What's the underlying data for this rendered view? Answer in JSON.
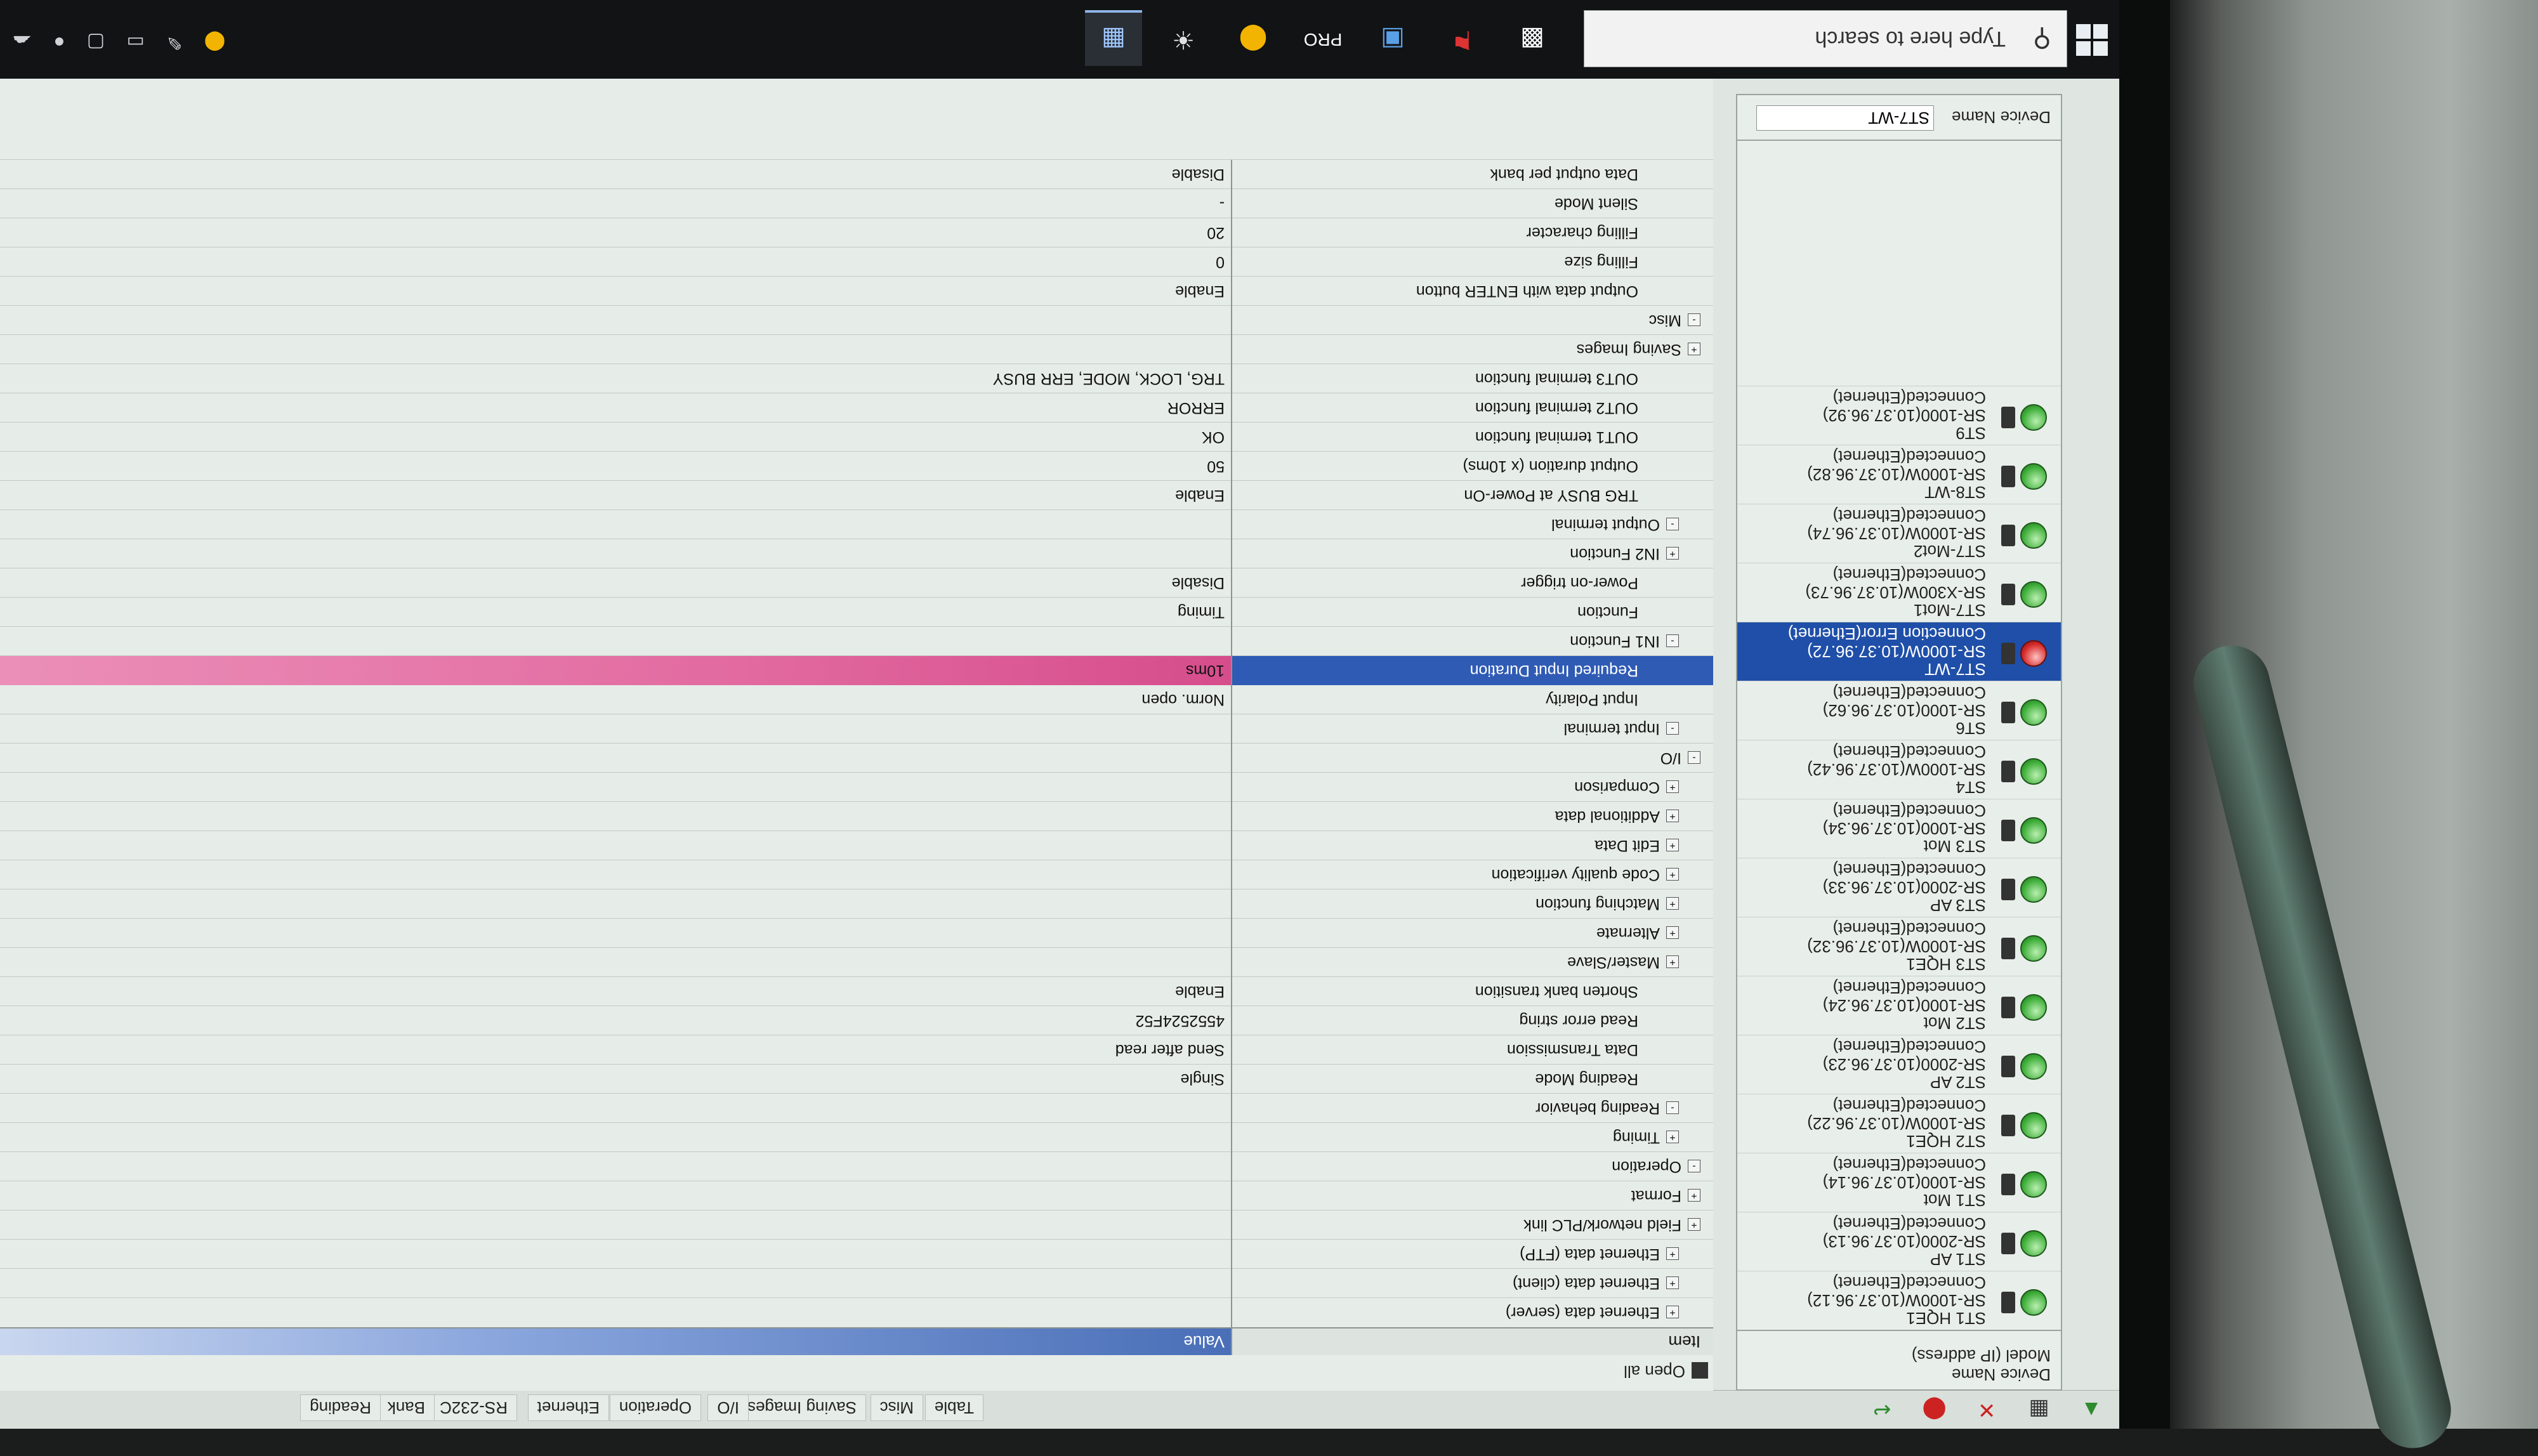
{
  "tabs": [
    "Table",
    "Misc",
    "Saving Images",
    "I/O",
    "Operation",
    "Ethernet",
    "RS-232C",
    "Bank",
    "Reading"
  ],
  "device_panel": {
    "header_line1": "Device Name",
    "header_line2": "Model (IP address)",
    "devices": [
      {
        "name": "ST1 HQE1",
        "model": "SR-1000W(10.37.96.12)",
        "status": "Connected(Ethernet)",
        "state": "ok"
      },
      {
        "name": "ST1 AP",
        "model": "SR-2000(10.37.96.13)",
        "status": "Connected(Ethernet)",
        "state": "ok"
      },
      {
        "name": "ST1 Mot",
        "model": "SR-1000(10.37.96.14)",
        "status": "Connected(Ethernet)",
        "state": "ok"
      },
      {
        "name": "ST2 HQE1",
        "model": "SR-1000W(10.37.96.22)",
        "status": "Connected(Ethernet)",
        "state": "ok"
      },
      {
        "name": "ST2 AP",
        "model": "SR-2000(10.37.96.23)",
        "status": "Connected(Ethernet)",
        "state": "ok"
      },
      {
        "name": "ST2 Mot",
        "model": "SR-1000(10.37.96.24)",
        "status": "Connected(Ethernet)",
        "state": "ok"
      },
      {
        "name": "ST3 HQE1",
        "model": "SR-1000W(10.37.96.32)",
        "status": "Connected(Ethernet)",
        "state": "ok"
      },
      {
        "name": "ST3 AP",
        "model": "SR-2000(10.37.96.33)",
        "status": "Connected(Ethernet)",
        "state": "ok"
      },
      {
        "name": "ST3 Mot",
        "model": "SR-1000(10.37.96.34)",
        "status": "Connected(Ethernet)",
        "state": "ok"
      },
      {
        "name": "ST4",
        "model": "SR-1000W(10.37.96.42)",
        "status": "Connected(Ethernet)",
        "state": "ok"
      },
      {
        "name": "ST6",
        "model": "SR-1000(10.37.96.62)",
        "status": "Connected(Ethernet)",
        "state": "ok"
      },
      {
        "name": "ST7-WT",
        "model": "SR-1000W(10.37.96.72)",
        "status": "Connection Error(Ethernet)",
        "state": "error",
        "selected": true
      },
      {
        "name": "ST7-Mot1",
        "model": "SR-X300W(10.37.96.73)",
        "status": "Connected(Ethernet)",
        "state": "ok"
      },
      {
        "name": "ST7-Mot2",
        "model": "SR-1000W(10.37.96.74)",
        "status": "Connected(Ethernet)",
        "state": "ok"
      },
      {
        "name": "ST8-WT",
        "model": "SR-1000W(10.37.96.82)",
        "status": "Connected(Ethernet)",
        "state": "ok"
      },
      {
        "name": "ST9",
        "model": "SR-1000(10.37.96.92)",
        "status": "Connected(Ethernet)",
        "state": "ok"
      }
    ],
    "device_name_label": "Device Name",
    "device_name_value": "ST7-WT"
  },
  "grid": {
    "open_all_label": "Open all",
    "col_item": "Item",
    "col_value": "Value",
    "rows": [
      {
        "indent": 1,
        "toggle": "+",
        "item": "Ethernet data (server)",
        "value": ""
      },
      {
        "indent": 1,
        "toggle": "+",
        "item": "Ethernet data (client)",
        "value": ""
      },
      {
        "indent": 1,
        "toggle": "+",
        "item": "Ethernet data (FTP)",
        "value": ""
      },
      {
        "indent": 0,
        "toggle": "+",
        "item": "Field network/PLC link",
        "value": ""
      },
      {
        "indent": 0,
        "toggle": "+",
        "item": "Format",
        "value": ""
      },
      {
        "indent": 0,
        "toggle": "-",
        "item": "Operation",
        "value": ""
      },
      {
        "indent": 1,
        "toggle": "+",
        "item": "Timing",
        "value": ""
      },
      {
        "indent": 1,
        "toggle": "-",
        "item": "Reading behavior",
        "value": ""
      },
      {
        "indent": 2,
        "toggle": "",
        "item": "Reading Mode",
        "value": "Single"
      },
      {
        "indent": 2,
        "toggle": "",
        "item": "Data Transmission",
        "value": "Send after read"
      },
      {
        "indent": 2,
        "toggle": "",
        "item": "Read error string",
        "value": "4552524F52"
      },
      {
        "indent": 2,
        "toggle": "",
        "item": "Shorten bank transition",
        "value": "Enable"
      },
      {
        "indent": 1,
        "toggle": "+",
        "item": "Master/Slave",
        "value": ""
      },
      {
        "indent": 1,
        "toggle": "+",
        "item": "Alternate",
        "value": ""
      },
      {
        "indent": 1,
        "toggle": "+",
        "item": "Matching function",
        "value": ""
      },
      {
        "indent": 1,
        "toggle": "+",
        "item": "Code quality verification",
        "value": ""
      },
      {
        "indent": 1,
        "toggle": "+",
        "item": "Edit Data",
        "value": ""
      },
      {
        "indent": 1,
        "toggle": "+",
        "item": "Additional data",
        "value": ""
      },
      {
        "indent": 1,
        "toggle": "+",
        "item": "Comparison",
        "value": ""
      },
      {
        "indent": 0,
        "toggle": "-",
        "item": "I/O",
        "value": ""
      },
      {
        "indent": 1,
        "toggle": "-",
        "item": "Input terminal",
        "value": ""
      },
      {
        "indent": 2,
        "toggle": "",
        "item": "Input Polarity",
        "value": "Norm. open"
      },
      {
        "indent": 2,
        "toggle": "",
        "item": "Required Input Duration",
        "value": "10ms",
        "highlight": true
      },
      {
        "indent": 1,
        "toggle": "-",
        "item": "IN1 Function",
        "value": ""
      },
      {
        "indent": 2,
        "toggle": "",
        "item": "Function",
        "value": "Timing"
      },
      {
        "indent": 2,
        "toggle": "",
        "item": "Power-on trigger",
        "value": "Disable"
      },
      {
        "indent": 1,
        "toggle": "+",
        "item": "IN2 Function",
        "value": ""
      },
      {
        "indent": 1,
        "toggle": "-",
        "item": "Output terminal",
        "value": ""
      },
      {
        "indent": 2,
        "toggle": "",
        "item": "TRG BUSY at Power-On",
        "value": "Enable"
      },
      {
        "indent": 2,
        "toggle": "",
        "item": "Output duration (x 10ms)",
        "value": "50"
      },
      {
        "indent": 2,
        "toggle": "",
        "item": "OUT1 terminal function",
        "value": "OK"
      },
      {
        "indent": 2,
        "toggle": "",
        "item": "OUT2 terminal function",
        "value": "ERROR"
      },
      {
        "indent": 2,
        "toggle": "",
        "item": "OUT3 terminal function",
        "value": "TRG, LOCK, MODE, ERR BUSY"
      },
      {
        "indent": 0,
        "toggle": "+",
        "item": "Saving Images",
        "value": ""
      },
      {
        "indent": 0,
        "toggle": "-",
        "item": "Misc",
        "value": ""
      },
      {
        "indent": 2,
        "toggle": "",
        "item": "Output data with ENTER button",
        "value": "Enable"
      },
      {
        "indent": 2,
        "toggle": "",
        "item": "Filling size",
        "value": "0"
      },
      {
        "indent": 2,
        "toggle": "",
        "item": "Filling character",
        "value": "20"
      },
      {
        "indent": 2,
        "toggle": "",
        "item": "Silent Mode",
        "value": "-"
      },
      {
        "indent": 2,
        "toggle": "",
        "item": "Data output per bank",
        "value": "Disable"
      }
    ]
  },
  "taskbar": {
    "search_placeholder": "Type here to search",
    "apps": [
      "terminal",
      "tool",
      "camera",
      "PRO",
      "chrome",
      "paint",
      "keyence-app"
    ],
    "pro_label": "PRO"
  },
  "colors": {
    "selected_row": "#2f5bb5",
    "highlight_value": "#e26aa0",
    "ok_led": "#3fae3a",
    "error_led": "#d62a2a"
  }
}
